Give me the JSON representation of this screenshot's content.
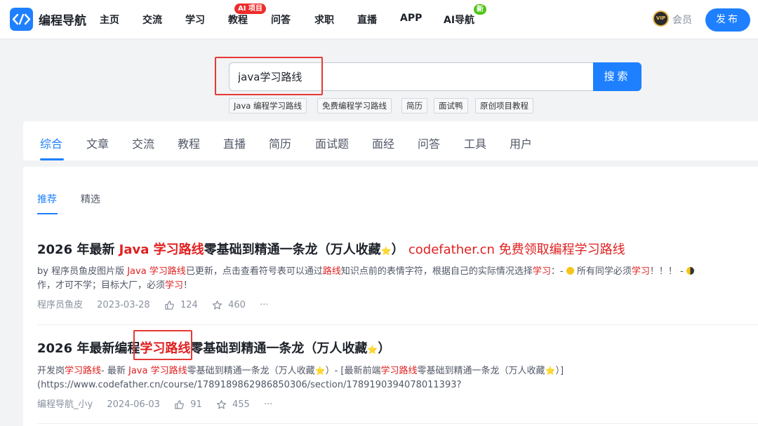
{
  "header": {
    "logo_text": "编程导航",
    "nav": [
      "主页",
      "交流",
      "学习",
      "教程",
      "问答",
      "求职",
      "直播",
      "APP",
      "AI导航"
    ],
    "badges": {
      "tutorial": "AI 项目",
      "ai_nav": "新"
    },
    "vip_label": "会员",
    "vip_icon_text": "VIP",
    "publish_label": "发布"
  },
  "search": {
    "value": "java学习路线",
    "button_label": "搜索",
    "tags": [
      "Java 编程学习路线",
      "免费编程学习路线",
      "简历",
      "面试鸭",
      "原创项目教程"
    ]
  },
  "categories": [
    "综合",
    "文章",
    "交流",
    "教程",
    "直播",
    "简历",
    "面试题",
    "面经",
    "问答",
    "工具",
    "用户"
  ],
  "subtabs": [
    "推荐",
    "精选"
  ],
  "results": [
    {
      "title_parts": [
        "2026 年最新 ",
        "Java 学习路线",
        "零基础到精通一条龙（万人收藏",
        "⭐",
        "） ",
        "codefather.cn 免费领取编程学习路线"
      ],
      "desc_line1_parts": [
        "by 程序员鱼皮图片版 ",
        "Java 学习路线",
        "已更新，点击查看符号表可以通过",
        "路线",
        "知识点前的表情字符，根据自己的实际情况选择",
        "学习",
        "：- ",
        "所有同学必须",
        "学习",
        "！！！ - "
      ],
      "desc_line2_parts": [
        "作，才可不学；目标大厂，必须",
        "学习",
        "！"
      ],
      "author": "程序员鱼皮",
      "date": "2023-03-28",
      "likes": "124",
      "stars": "460",
      "more": "···"
    },
    {
      "title_parts": [
        "2026 年最新编程",
        "学习路线",
        "零基础到精通一条龙（万人收藏",
        "⭐",
        "）"
      ],
      "desc_line1_parts": [
        "开发岗",
        "学习路线",
        "- 最新 ",
        "Java 学习路线",
        "零基础到精通一条龙（万人收藏",
        "⭐",
        "）- [最新前端",
        "学习路线",
        "零基础到精通一条龙（万人收藏",
        "⭐",
        "）]"
      ],
      "desc_line2": "(https://www.codefather.cn/course/1789189862986850306/section/1789190394078011393?",
      "author": "编程导航_小y",
      "date": "2024-06-03",
      "likes": "91",
      "stars": "455",
      "more": "···"
    }
  ],
  "colors": {
    "accent": "#1e80ff",
    "highlight": "#e02020",
    "annotation_box": "#e53935"
  }
}
